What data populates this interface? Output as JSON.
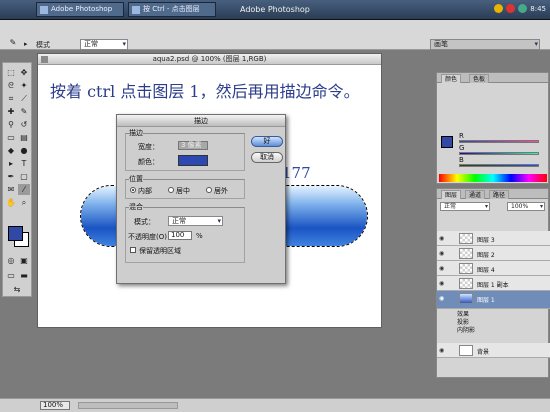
{
  "taskbar": {
    "buttons": [
      "Adobe Photoshop",
      "按 Ctrl - 点击图层"
    ],
    "title": "Adobe Photoshop",
    "clock": "8:45"
  },
  "options": {
    "menu": "▸",
    "mode_label": "模式",
    "mode_value": "正常",
    "right_field": "画笔"
  },
  "document": {
    "title": "aqua2.psd @ 100% (图层 1,RGB)",
    "instruction": "按着 ctrl 点击图层 1，然后再用描边命令。",
    "rgb_annotation": "R43 G73 B177"
  },
  "dialog": {
    "title": "描边",
    "ok_label": "好",
    "cancel_label": "取消",
    "stroke_group": "描边",
    "width_label": "宽度：",
    "width_value": "3 像素",
    "color_label": "颜色：",
    "stroke_color": "#2b49b1",
    "location_group": "位置",
    "location_options": [
      "内部",
      "居中",
      "居外"
    ],
    "blend_group": "混合",
    "mode_label": "模式：",
    "mode_value": "正常",
    "opacity_label": "不透明度(O)：",
    "opacity_value": "100",
    "opacity_unit": "%",
    "preserve_label": "保留透明区域"
  },
  "color_panel": {
    "tabs": [
      "颜色",
      "色板"
    ],
    "channels": [
      "R",
      "G",
      "B"
    ]
  },
  "layers_panel": {
    "tabs": [
      "图层",
      "通道",
      "路径"
    ],
    "mode": "正常",
    "opacity": "100%",
    "layers": [
      "图层 3",
      "图层 2",
      "图层 4",
      "图层 1 副本",
      "图层 1",
      "背景"
    ],
    "effects": [
      "效果",
      "投影",
      "内阴影"
    ]
  },
  "statusbar": {
    "zoom": "100%"
  }
}
